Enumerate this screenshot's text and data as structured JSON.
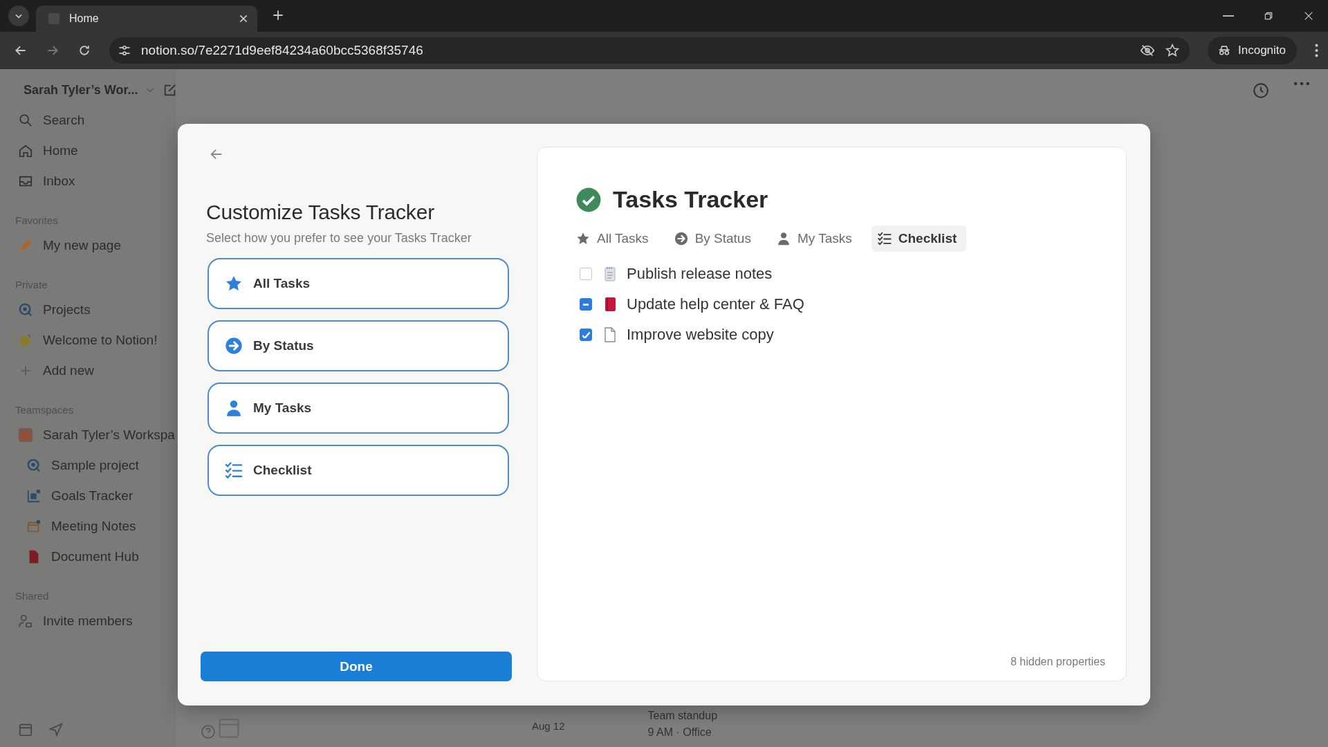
{
  "browser": {
    "tab_title": "Home",
    "url": "notion.so/7e2271d9eef84234a60bcc5368f35746",
    "incognito_label": "Incognito"
  },
  "sidebar": {
    "workspace": "Sarah Tyler’s Wor...",
    "nav": [
      {
        "label": "Search"
      },
      {
        "label": "Home"
      },
      {
        "label": "Inbox"
      }
    ],
    "sections": [
      {
        "title": "Favorites",
        "items": [
          {
            "label": "My new page"
          }
        ]
      },
      {
        "title": "Private",
        "items": [
          {
            "label": "Projects"
          },
          {
            "label": "Welcome to Notion!"
          },
          {
            "label": "Add new"
          }
        ]
      },
      {
        "title": "Teamspaces",
        "items": [
          {
            "label": "Sarah Tyler’s Workspa",
            "children": [
              {
                "label": "Sample project"
              },
              {
                "label": "Goals Tracker"
              },
              {
                "label": "Meeting Notes"
              },
              {
                "label": "Document Hub"
              }
            ]
          }
        ]
      },
      {
        "title": "Shared",
        "items": [
          {
            "label": "Invite members"
          }
        ]
      }
    ]
  },
  "background_page": {
    "date": "Aug 12",
    "event_title": "Team standup",
    "event_detail": "9 AM · Office"
  },
  "dialog": {
    "title": "Customize Tasks Tracker",
    "subtitle": "Select how you prefer to see your Tasks Tracker",
    "options": [
      {
        "label": "All Tasks"
      },
      {
        "label": "By Status"
      },
      {
        "label": "My Tasks"
      },
      {
        "label": "Checklist"
      }
    ],
    "done_label": "Done"
  },
  "preview": {
    "title": "Tasks Tracker",
    "tabs": [
      {
        "label": "All Tasks",
        "selected": false
      },
      {
        "label": "By Status",
        "selected": false
      },
      {
        "label": "My Tasks",
        "selected": false
      },
      {
        "label": "Checklist",
        "selected": true
      }
    ],
    "tasks": [
      {
        "label": "Publish release notes",
        "checked": false,
        "partial": false
      },
      {
        "label": "Update help center & FAQ",
        "checked": true,
        "partial": true
      },
      {
        "label": "Improve website copy",
        "checked": true,
        "partial": false
      }
    ],
    "footer": "8 hidden properties"
  }
}
